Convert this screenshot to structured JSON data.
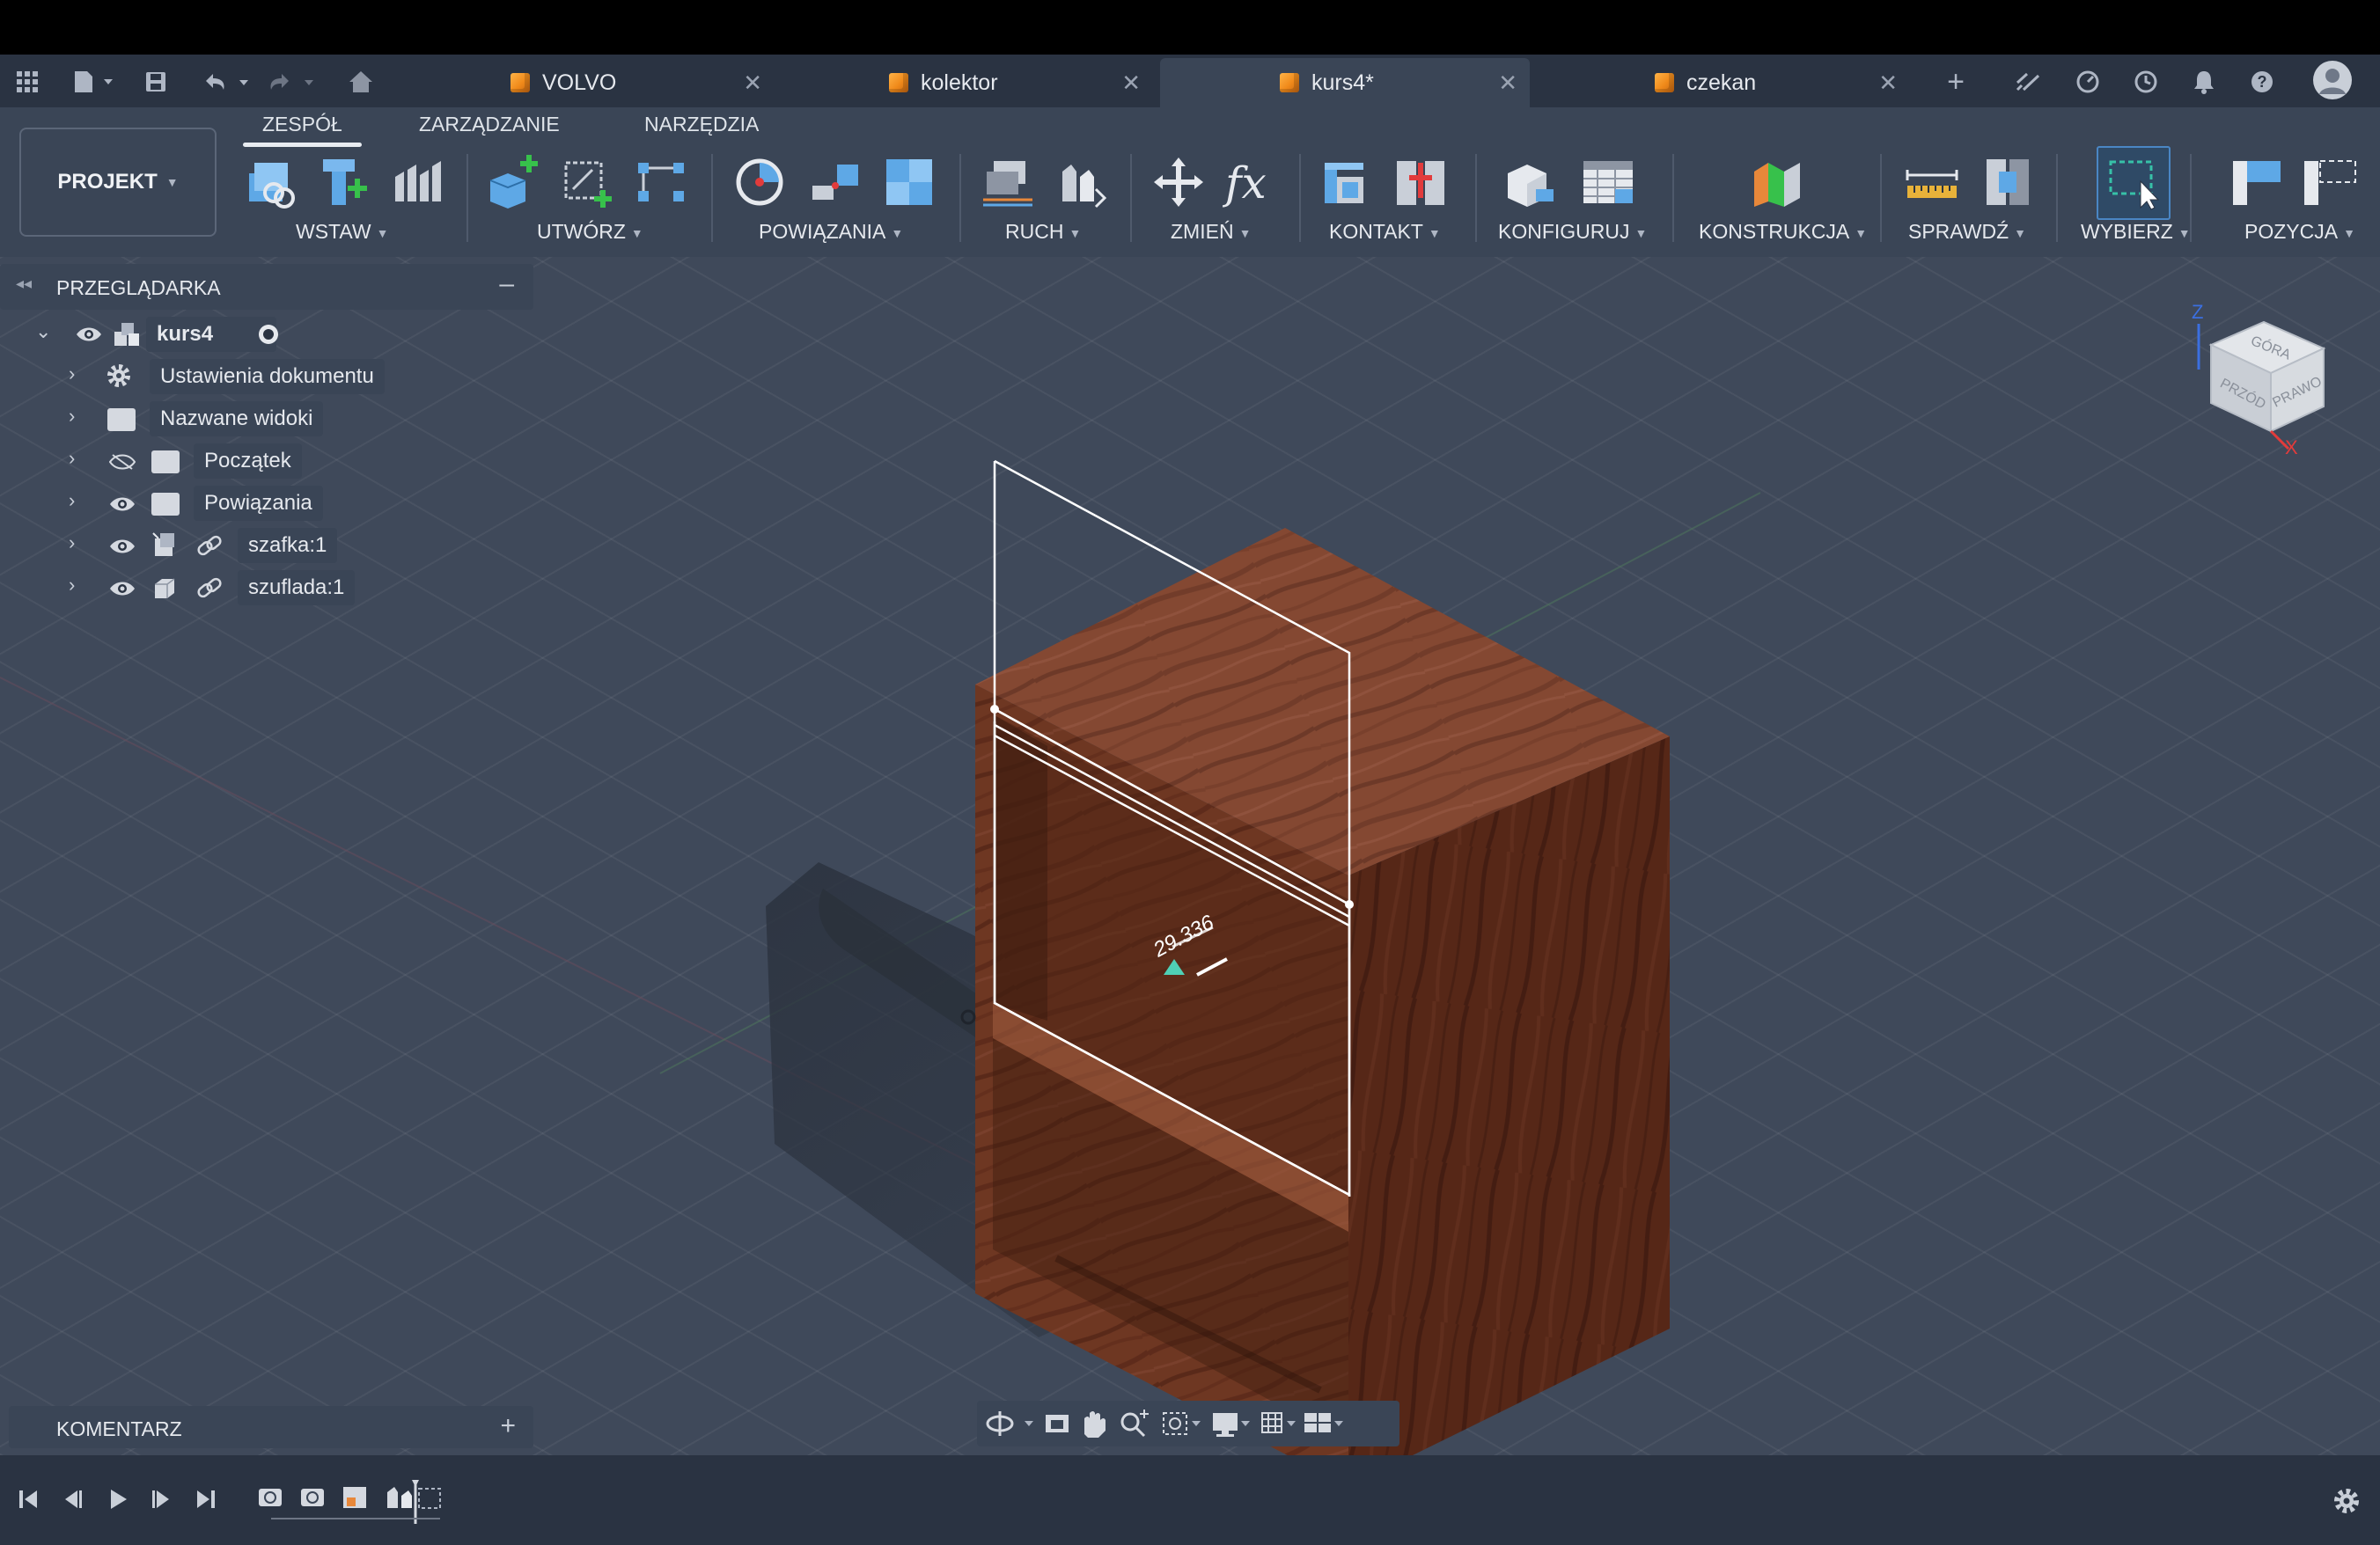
{
  "app": {
    "tabs": [
      {
        "label": "VOLVO",
        "active": false
      },
      {
        "label": "kolektor",
        "active": false
      },
      {
        "label": "kurs4*",
        "active": true
      },
      {
        "label": "czekan",
        "active": false
      }
    ]
  },
  "ribbon": {
    "tabs": [
      "ZESPÓŁ",
      "ZARZĄDZANIE",
      "NARZĘDZIA"
    ],
    "active_tab": "ZESPÓŁ",
    "projekt_label": "PROJEKT",
    "groups": [
      "WSTAW",
      "UTWÓRZ",
      "POWIĄZANIA",
      "RUCH",
      "ZMIEŃ",
      "KONTAKT",
      "KONFIGURUJ",
      "KONSTRUKCJA",
      "SPRAWDŹ",
      "WYBIERZ",
      "POZYCJA"
    ]
  },
  "browser": {
    "title": "PRZEGLĄDARKA",
    "root": "kurs4",
    "items": [
      "Ustawienia dokumentu",
      "Nazwane widoki",
      "Początek",
      "Powiązania",
      "szafka:1",
      "szuflada:1"
    ]
  },
  "viewport": {
    "dimension_value": "29.336",
    "viewcube_labels": {
      "top": "GÓRA",
      "front": "PRZÓD",
      "right": "PRAWO",
      "axis_z": "Z",
      "axis_x": "X"
    }
  },
  "comments": {
    "title": "KOMENTARZ"
  },
  "colors": {
    "accent_orange": "#f08a1a",
    "ribbon_bg": "#3a4556",
    "viewport_bg": "#3f495a",
    "wood_light": "#8b4a30",
    "wood_dark": "#5a2a1a"
  }
}
